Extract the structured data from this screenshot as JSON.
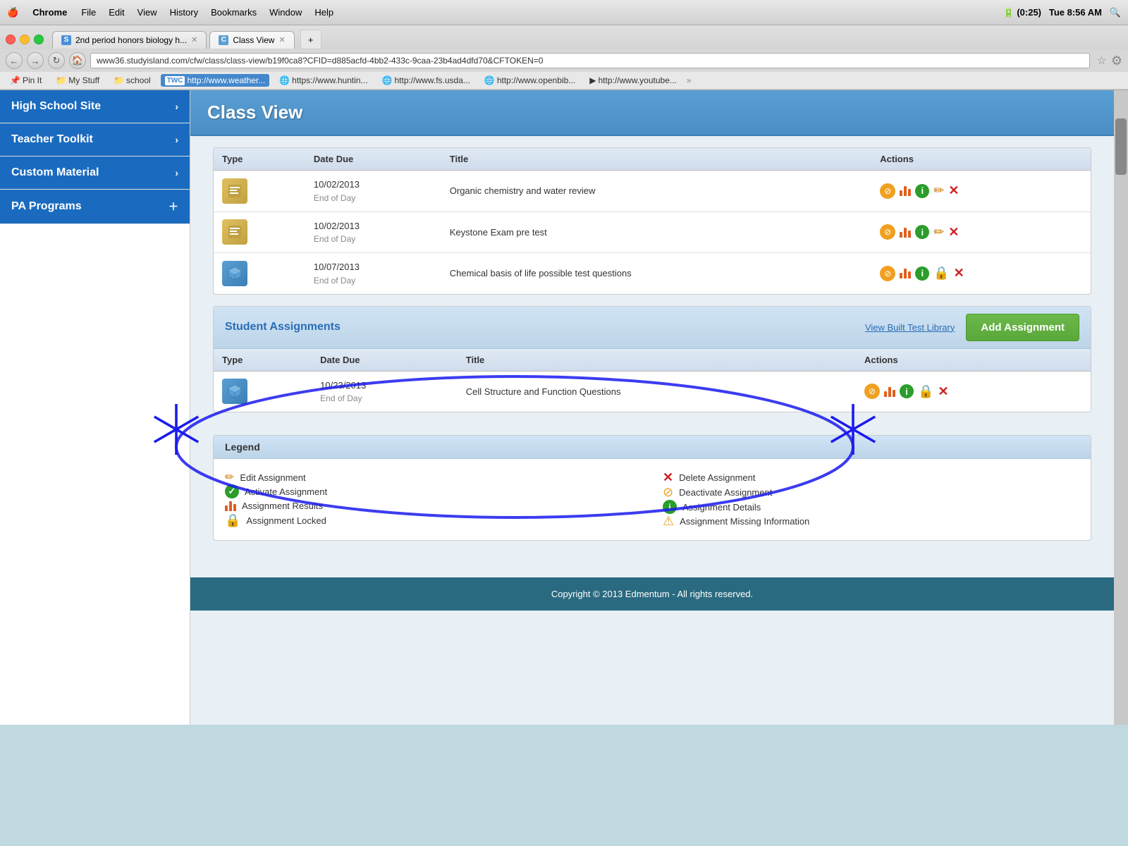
{
  "mac_bar": {
    "apple": "⌘",
    "app_name": "Chrome",
    "menus": [
      "File",
      "Edit",
      "View",
      "History",
      "Bookmarks",
      "Window",
      "Help"
    ],
    "time": "Tue 8:56 AM",
    "battery": "(0:25)"
  },
  "tabs": [
    {
      "label": "2nd period honors biology h...",
      "active": false,
      "favicon": "S"
    },
    {
      "label": "Class View",
      "active": true,
      "favicon": "C"
    }
  ],
  "address_bar": {
    "url": "www36.studyisland.com/cfw/class/class-view/b19f0ca8?CFID=d885acfd-4bb2-433c-9caa-23b4ad4dfd70&CFTOKEN=0"
  },
  "bookmarks": [
    {
      "label": "Pin It",
      "icon": "📌"
    },
    {
      "label": "My Stuff",
      "icon": "📁"
    },
    {
      "label": "school",
      "icon": "📁"
    },
    {
      "label": "http://www.weather...",
      "icon": "🌐"
    },
    {
      "label": "https://www.huntin...",
      "icon": "🌐"
    },
    {
      "label": "http://www.fs.usda...",
      "icon": "🌐"
    },
    {
      "label": "http://www.openbib...",
      "icon": "🌐"
    },
    {
      "label": "http://www.youtube...",
      "icon": "▶"
    }
  ],
  "sidebar": {
    "items": [
      {
        "label": "High School Site",
        "style": "blue",
        "has_arrow": true
      },
      {
        "label": "Teacher Toolkit",
        "style": "blue",
        "has_arrow": true
      },
      {
        "label": "Custom Material",
        "style": "blue",
        "has_arrow": true
      },
      {
        "label": "PA Programs",
        "style": "blue",
        "has_plus": true
      }
    ]
  },
  "page_header": {
    "title": "Class View"
  },
  "teacher_assignments": {
    "rows": [
      {
        "type": "quiz",
        "date": "10/02/2013",
        "date_sub": "End of Day",
        "title": "Organic chemistry and water review",
        "actions": [
          "deactivate",
          "results",
          "info",
          "edit",
          "delete"
        ]
      },
      {
        "type": "quiz",
        "date": "10/02/2013",
        "date_sub": "End of Day",
        "title": "Keystone Exam pre test",
        "actions": [
          "deactivate",
          "results",
          "info",
          "edit",
          "delete"
        ]
      },
      {
        "type": "cube",
        "date": "10/07/2013",
        "date_sub": "End of Day",
        "title": "Chemical basis of life possible test questions",
        "actions": [
          "deactivate",
          "results",
          "info",
          "lock",
          "delete"
        ]
      }
    ],
    "columns": {
      "type": "Type",
      "date": "Date Due",
      "title": "Title",
      "actions": "Actions"
    }
  },
  "student_assignments": {
    "section_title": "Student Assignments",
    "view_library_label": "View Built Test Library",
    "add_button_label": "Add Assignment",
    "columns": {
      "type": "Type",
      "date": "Date Due",
      "title": "Title",
      "actions": "Actions"
    },
    "rows": [
      {
        "type": "cube",
        "date": "10/23/2013",
        "date_sub": "End of Day",
        "title": "Cell Structure and Function Questions",
        "actions": [
          "deactivate",
          "results",
          "info",
          "lock",
          "delete"
        ]
      }
    ]
  },
  "legend": {
    "title": "Legend",
    "items_left": [
      {
        "icon": "pencil",
        "label": "Edit Assignment",
        "color": "#cc7700"
      },
      {
        "icon": "check",
        "label": "Activate Assignment",
        "color": "#2a9d2a"
      },
      {
        "icon": "bar-chart",
        "label": "Assignment Results",
        "color": "#e06020"
      },
      {
        "icon": "lock",
        "label": "Assignment Locked",
        "color": "#cc9922"
      }
    ],
    "items_right": [
      {
        "icon": "x",
        "label": "Delete Assignment",
        "color": "#cc2222"
      },
      {
        "icon": "no",
        "label": "Deactivate Assignment",
        "color": "#f0a020"
      },
      {
        "icon": "info",
        "label": "Assignment Details",
        "color": "#2a9d2a"
      },
      {
        "icon": "warning",
        "label": "Assignment Missing Information",
        "color": "#e0a020"
      }
    ]
  },
  "footer": {
    "text": "Copyright © 2013 Edmentum - All rights reserved."
  }
}
